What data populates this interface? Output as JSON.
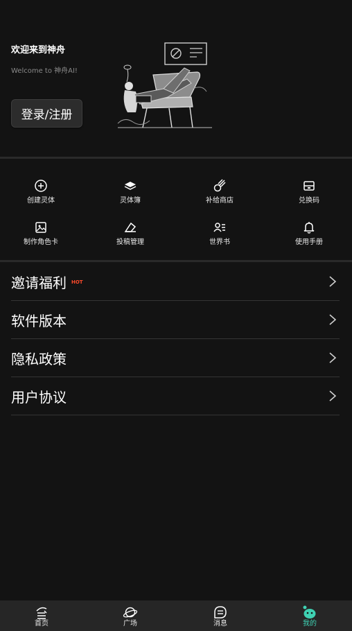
{
  "header": {
    "welcome_title": "欢迎来到神舟",
    "welcome_subtitle": "Welcome to 神舟AI!",
    "login_label": "登录/注册"
  },
  "grid": {
    "items": [
      {
        "label": "创建灵体",
        "icon": "plus-circle-icon"
      },
      {
        "label": "灵体簿",
        "icon": "book-stack-icon"
      },
      {
        "label": "补给商店",
        "icon": "meteor-icon"
      },
      {
        "label": "兑换码",
        "icon": "ticket-icon"
      },
      {
        "label": "制作角色卡",
        "icon": "image-icon"
      },
      {
        "label": "投稿管理",
        "icon": "eraser-icon"
      },
      {
        "label": "世界书",
        "icon": "user-list-icon"
      },
      {
        "label": "使用手册",
        "icon": "bell-icon"
      }
    ]
  },
  "menu": {
    "items": [
      {
        "label": "邀请福利",
        "badge": "HOT"
      },
      {
        "label": "软件版本"
      },
      {
        "label": "隐私政策"
      },
      {
        "label": "用户协议"
      }
    ]
  },
  "tabbar": {
    "tabs": [
      {
        "label": "首页",
        "icon": "home-icon"
      },
      {
        "label": "广场",
        "icon": "planet-icon"
      },
      {
        "label": "消息",
        "icon": "message-icon"
      },
      {
        "label": "我的",
        "icon": "mascot-icon",
        "active": true
      }
    ],
    "active_color": "#3fd1b3"
  }
}
